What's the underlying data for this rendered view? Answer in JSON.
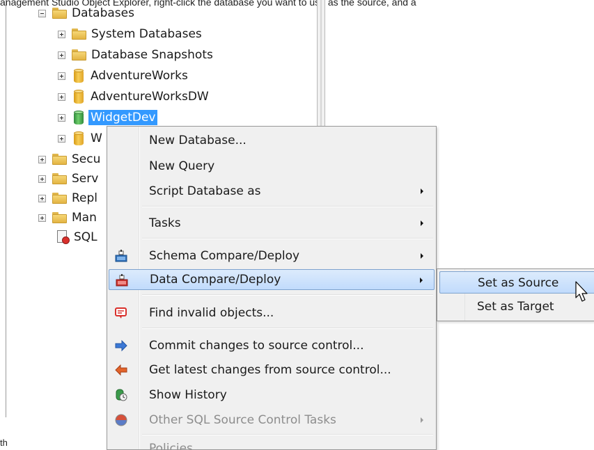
{
  "caption": "anagement Studio Object Explorer, right-click the database you want to use as the source, and a",
  "tree": {
    "databases_label": "Databases",
    "children": [
      {
        "label": "System Databases"
      },
      {
        "label": "Database Snapshots"
      },
      {
        "label": "AdventureWorks"
      },
      {
        "label": "AdventureWorksDW"
      },
      {
        "label": "WidgetDev"
      },
      {
        "label": "W"
      }
    ],
    "siblings": [
      {
        "label": "Secu"
      },
      {
        "label": "Serv"
      },
      {
        "label": "Repl"
      },
      {
        "label": "Man"
      },
      {
        "label": "SQL"
      }
    ]
  },
  "context_menu": {
    "items": [
      {
        "label": "New Database..."
      },
      {
        "label": "New Query"
      },
      {
        "label": "Script Database as"
      },
      {
        "label": "Tasks"
      },
      {
        "label": "Schema Compare/Deploy"
      },
      {
        "label": "Data Compare/Deploy"
      },
      {
        "label": "Find invalid objects..."
      },
      {
        "label": "Commit changes to source control..."
      },
      {
        "label": "Get latest changes from source control..."
      },
      {
        "label": "Show History"
      },
      {
        "label": "Other SQL Source Control Tasks"
      },
      {
        "label": "Policies"
      }
    ]
  },
  "submenu": {
    "items": [
      {
        "label": "Set as Source"
      },
      {
        "label": "Set as Target"
      }
    ]
  },
  "footer_text": "th",
  "colors": {
    "selection": "#3399ff",
    "menu_highlight": "#c1dbfc",
    "menu_bg": "#f0f0f0"
  }
}
